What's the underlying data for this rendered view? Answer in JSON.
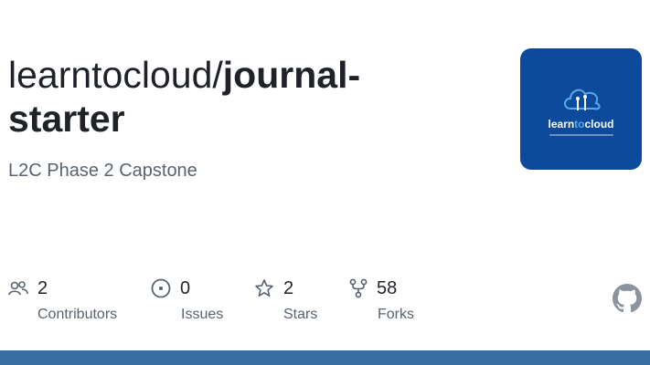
{
  "repo": {
    "owner": "learntocloud/",
    "name": "journal-starter",
    "name_line1": "journal-",
    "name_line2": "starter",
    "description": "L2C Phase 2 Capstone"
  },
  "logo": {
    "text_a": "learn",
    "text_b": "to",
    "text_c": "cloud",
    "bg_color": "#0d4a9c"
  },
  "stats": {
    "contributors": {
      "value": "2",
      "label": "Contributors",
      "icon": "people-icon"
    },
    "issues": {
      "value": "0",
      "label": "Issues",
      "icon": "issue-icon"
    },
    "stars": {
      "value": "2",
      "label": "Stars",
      "icon": "star-icon"
    },
    "forks": {
      "value": "58",
      "label": "Forks",
      "icon": "fork-icon"
    }
  },
  "colors": {
    "accent_bar": "#3a6fa3",
    "text_primary": "#1f2328",
    "text_secondary": "#59636e"
  }
}
